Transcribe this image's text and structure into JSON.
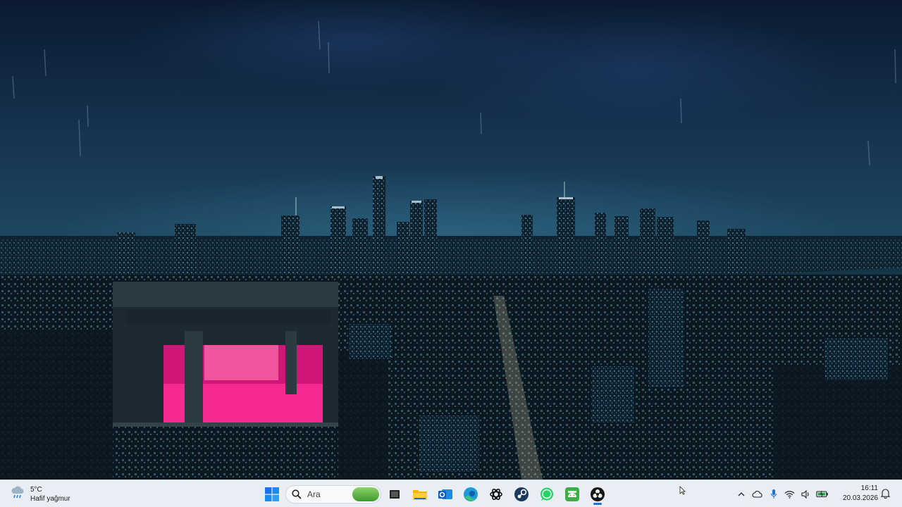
{
  "wallpaper": {
    "description_icon": "night-city-skyline-wallpaper"
  },
  "taskbar": {
    "weather": {
      "temperature": "5°C",
      "condition": "Hafif yağmur",
      "icon": "rain-cloud-icon"
    },
    "search": {
      "placeholder": "Ara"
    },
    "pinned": [
      {
        "name": "windows-start-button",
        "icon": "windows-logo-icon"
      },
      {
        "name": "task-view-app",
        "icon": "task-view-icon"
      },
      {
        "name": "file-explorer-app",
        "icon": "folder-icon"
      },
      {
        "name": "outlook-app",
        "icon": "outlook-icon"
      },
      {
        "name": "edge-app",
        "icon": "edge-icon"
      },
      {
        "name": "chatgpt-app",
        "icon": "chatgpt-icon"
      },
      {
        "name": "steam-app",
        "icon": "steam-icon"
      },
      {
        "name": "whatsapp-app",
        "icon": "whatsapp-icon"
      },
      {
        "name": "android-app",
        "icon": "android-icon"
      },
      {
        "name": "obs-app",
        "icon": "obs-icon"
      }
    ],
    "tray": {
      "icons": [
        "chevron-up-icon",
        "onedrive-cloud-icon",
        "microphone-icon",
        "wifi-icon",
        "speaker-icon",
        "battery-icon"
      ]
    },
    "clock": {
      "time": "16:11",
      "date": "20.03.2026"
    },
    "colors": {
      "taskbar_bg": "#e9eef4",
      "accent": "#2a6fd8"
    }
  }
}
